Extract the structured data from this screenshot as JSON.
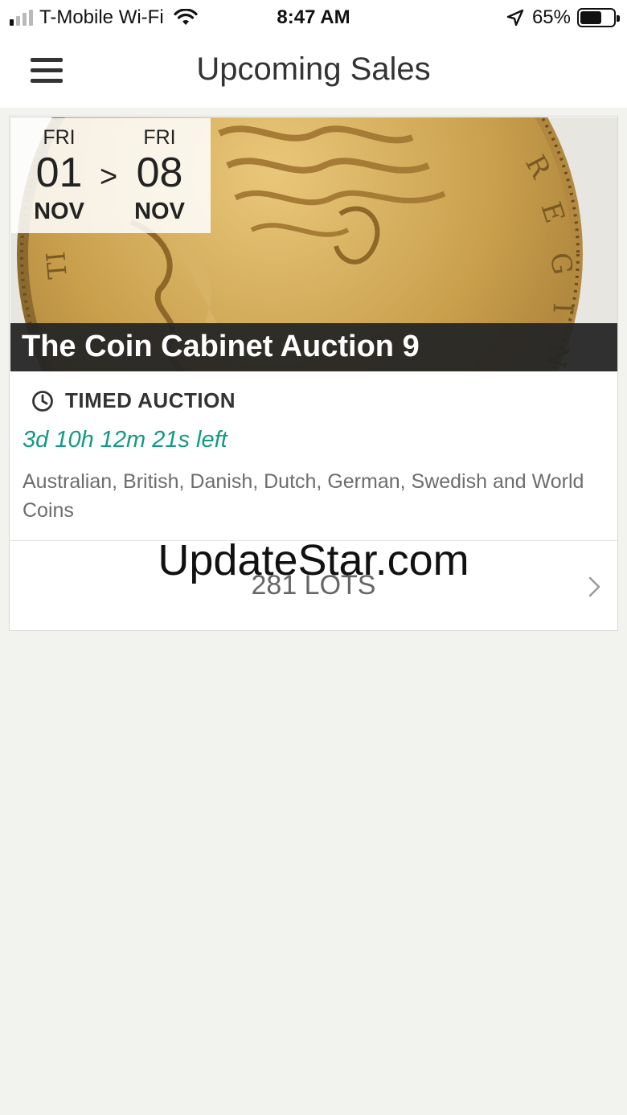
{
  "status_bar": {
    "carrier": "T-Mobile Wi-Fi",
    "time": "8:47 AM",
    "battery_percent": "65%",
    "battery_level": 0.65,
    "signal_bars_active": 1,
    "signal_bars_total": 4,
    "icons": [
      "signal-icon",
      "wifi-icon",
      "location-arrow-icon",
      "battery-icon"
    ]
  },
  "nav": {
    "title": "Upcoming Sales",
    "menu_icon": "hamburger-menu-icon"
  },
  "sale": {
    "image_description_icon": "coin-image",
    "start": {
      "weekday": "FRI",
      "day": "01",
      "month": "NOV"
    },
    "end": {
      "weekday": "FRI",
      "day": "08",
      "month": "NOV"
    },
    "range_separator": ">",
    "title": "The Coin Cabinet Auction 9",
    "type_icon": "clock-icon",
    "type": "TIMED AUCTION",
    "time_left": "3d 10h 12m 21s left",
    "description": "Australian, British, Danish, Dutch, German, Swedish and World Coins",
    "lots": "281 LOTS",
    "chevron_icon": "chevron-right-icon"
  },
  "colors": {
    "accent": "#139a82",
    "background": "#f2f2ee",
    "title_band": "#262626",
    "coin_gold": "#c9a24f"
  },
  "watermark": "UpdateStar.com"
}
